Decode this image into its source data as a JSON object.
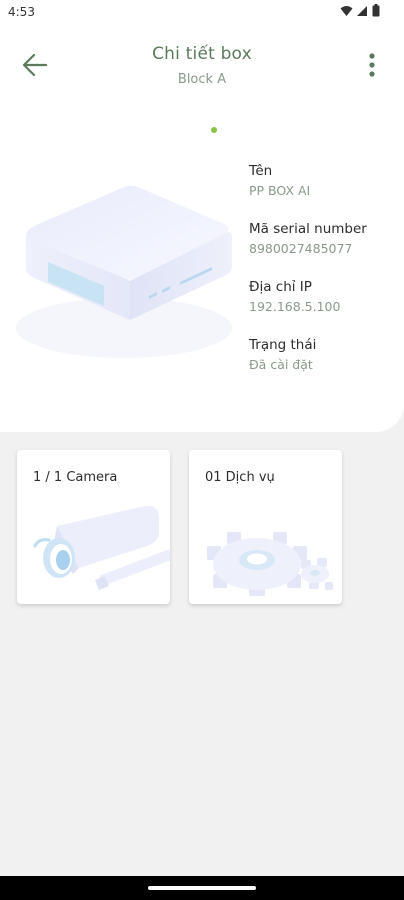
{
  "status_bar": {
    "time": "4:53"
  },
  "header": {
    "title": "Chi tiết box",
    "subtitle": "Block A"
  },
  "device": {
    "fields": [
      {
        "label": "Tên",
        "value": "PP BOX AI"
      },
      {
        "label": "Mã serial number",
        "value": "8980027485077"
      },
      {
        "label": "Địa chỉ IP",
        "value": "192.168.5.100"
      },
      {
        "label": "Trạng thái",
        "value": "Đã cài đặt"
      }
    ]
  },
  "cards": [
    {
      "title": "1 / 1 Camera",
      "icon": "camera-icon"
    },
    {
      "title": "01 Dịch vụ",
      "icon": "gear-icon"
    }
  ],
  "colors": {
    "accent": "#5b7a5c",
    "indicator": "#8bc34a",
    "muted": "#8a9a8a"
  }
}
